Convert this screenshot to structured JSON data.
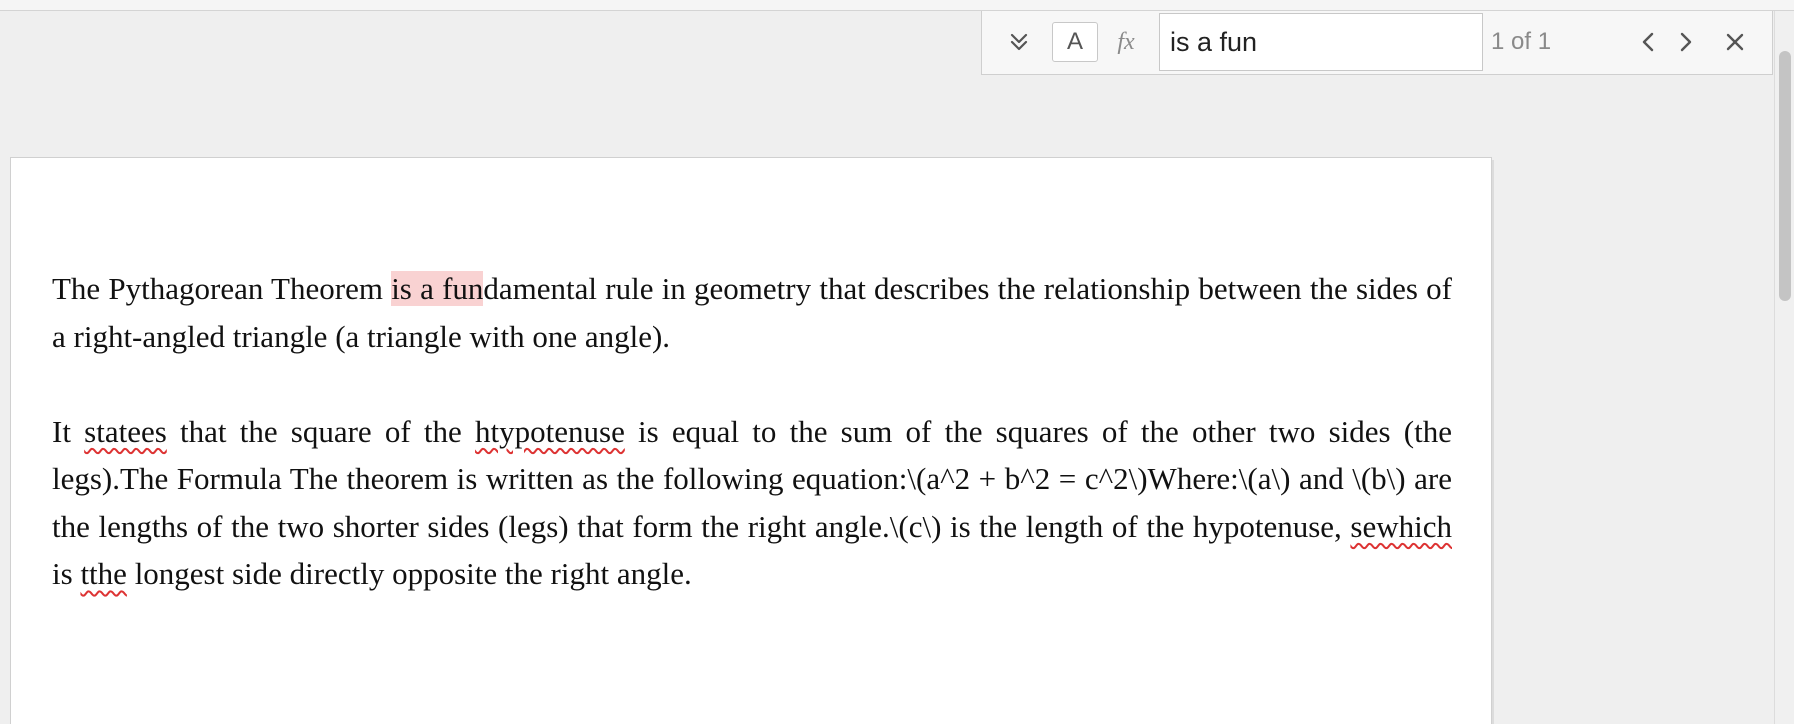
{
  "find_bar": {
    "expand_icon": "double-chevron-down-icon",
    "case_label": "A",
    "formula_label": "fx",
    "query": "is a fun",
    "match_count": "1 of 1",
    "prev_icon": "chevron-left-icon",
    "next_icon": "chevron-right-icon",
    "close_icon": "close-icon"
  },
  "document": {
    "paragraphs": [
      {
        "segments": [
          {
            "text": "The Pythagorean Theorem "
          },
          {
            "text": "is a fun",
            "style": "highlight"
          },
          {
            "text": "damental rule in geometry that describes the relationship between the sides of a right-angled triangle (a triangle with one angle)."
          }
        ]
      },
      {
        "segments": [
          {
            "text": "It "
          },
          {
            "text": "statees",
            "style": "misspelled"
          },
          {
            "text": " that the square of the "
          },
          {
            "text": "htypotenuse",
            "style": "misspelled"
          },
          {
            "text": " is equal to the sum of the squares of the other two sides (the legs).The Formula The theorem is written as the following equation:\\(a^2 + b^2 = c^2\\)Where:\\(a\\) and \\(b\\) are the lengths of the two shorter sides (legs) that form the right angle.\\(c\\) is the length of the hypotenuse, "
          },
          {
            "text": "sewhich",
            "style": "misspelled"
          },
          {
            "text": " is "
          },
          {
            "text": "tthe",
            "style": "misspelled"
          },
          {
            "text": " longest side directly opposite the right angle."
          }
        ]
      }
    ]
  },
  "colors": {
    "highlight": "#f9d2d2",
    "spellcheck": "#d33333",
    "background": "#efefef",
    "page": "#ffffff"
  }
}
